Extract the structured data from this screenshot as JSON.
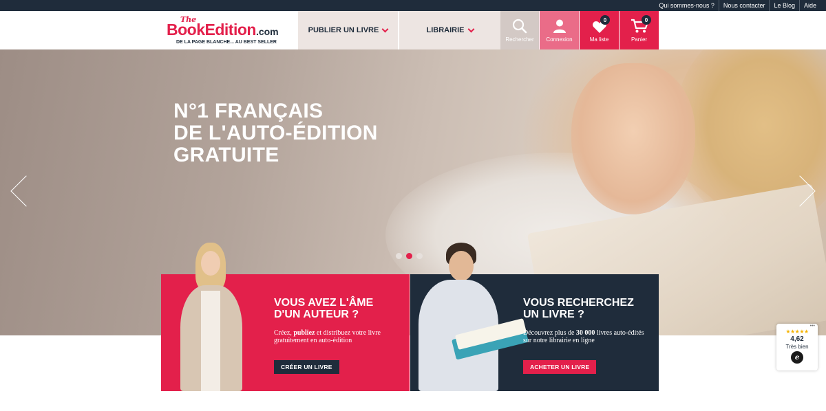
{
  "topbar": {
    "links": [
      "Qui sommes-nous ?",
      "Nous contacter",
      "Le Blog",
      "Aide"
    ]
  },
  "logo": {
    "the": "The",
    "brand": "BookEditi",
    "brand_o": "on",
    "dotcom": ".com",
    "tagline": "DE LA PAGE BLANCHE... AU BEST SELLER"
  },
  "nav": {
    "publier": "PUBLIER UN LIVRE",
    "librairie": "LIBRAIRIE"
  },
  "actions": {
    "search": "Rechercher",
    "login": "Connexion",
    "wishlist": "Ma liste",
    "wishlist_count": "0",
    "cart": "Panier",
    "cart_count": "0"
  },
  "hero": {
    "line1": "N°1 FRANÇAIS",
    "line2": "DE L'AUTO-ÉDITION",
    "line3": "GRATUITE",
    "slide_count": 3,
    "active_slide": 2
  },
  "cards": {
    "author": {
      "title_1": "VOUS AVEZ L'ÂME",
      "title_2": "D'UN AUTEUR ?",
      "text_pre": "Créez, ",
      "text_bold": "publiez",
      "text_post": " et distribuez votre livre gratuitement en auto-édition",
      "cta": "CRÉER UN LIVRE"
    },
    "reader": {
      "title_1": "VOUS RECHERCHEZ",
      "title_2": "UN LIVRE ?",
      "text_pre": "Découvrez plus de ",
      "text_bold": "30 000",
      "text_post": " livres auto-édités sur notre librairie en ligne",
      "cta": "ACHETER UN LIVRE"
    }
  },
  "trust": {
    "stars": "★★★★★",
    "score": "4,62",
    "label": "Très bien",
    "seal": "e",
    "more": "•••"
  },
  "colors": {
    "brand_red": "#e3204b",
    "navy": "#1f2c3b",
    "beige": "#ede5e2"
  }
}
